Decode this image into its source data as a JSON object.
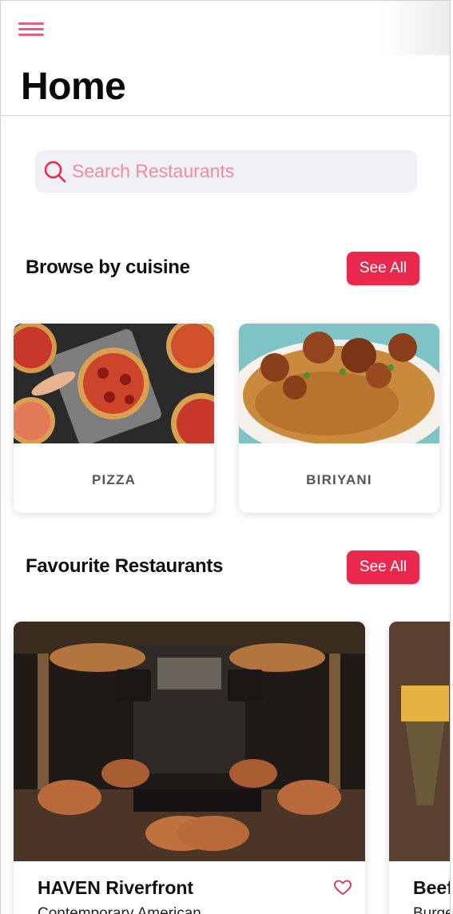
{
  "header": {
    "title": "Home",
    "menu_icon": "hamburger-menu-icon"
  },
  "search": {
    "placeholder": "Search Restaurants",
    "icon": "search-icon"
  },
  "cuisine_section": {
    "title": "Browse by cuisine",
    "see_all_label": "See All",
    "items": [
      {
        "label": "PIZZA",
        "image": "pizza-photo"
      },
      {
        "label": "BIRIYANI",
        "image": "biriyani-photo"
      }
    ]
  },
  "favourites_section": {
    "title": "Favourite Restaurants",
    "see_all_label": "See All",
    "items": [
      {
        "name": "HAVEN Riverfront",
        "subtitle": "Contemporary American",
        "image": "restaurant-interior-photo",
        "favorite_icon": "heart-outline-icon"
      },
      {
        "name": "Beef",
        "subtitle": "Burger",
        "image": "fries-photo"
      }
    ]
  },
  "colors": {
    "accent": "#e8284c",
    "menu_icon": "#e8607a",
    "placeholder": "#f08ca0",
    "search_bg": "#f0f0f4"
  }
}
